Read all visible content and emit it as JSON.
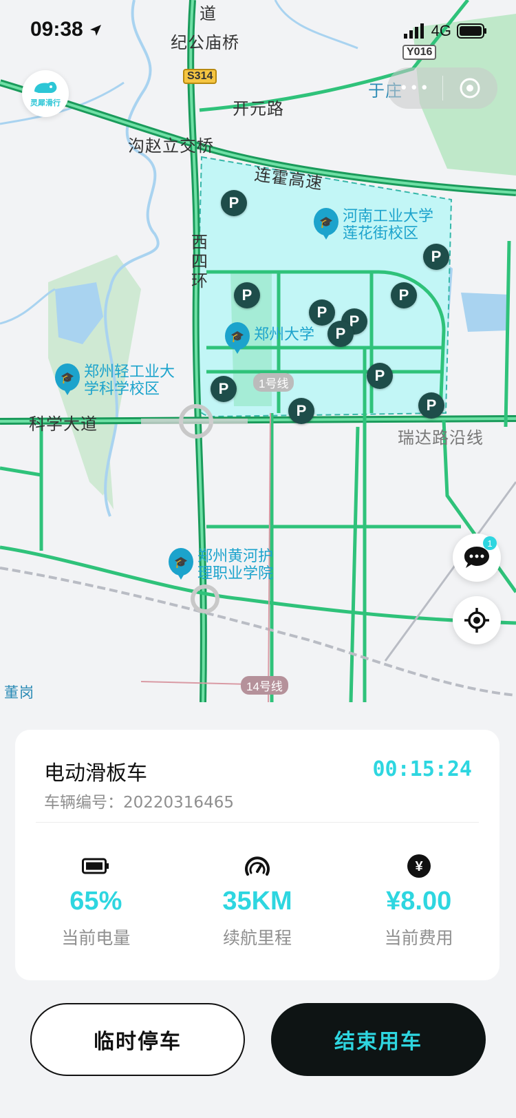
{
  "status_bar": {
    "time": "09:38",
    "network": "4G"
  },
  "app": {
    "logo_text": "灵犀滑行"
  },
  "map": {
    "labels": {
      "road_top": "道",
      "bridge1": "纪公庙桥",
      "kaiyuan": "开元路",
      "yuzhuang": "于庄",
      "gouzhao": "沟赵立交桥",
      "lianhuo": "连霍高速",
      "xisihuan": "西四环",
      "kexue": "科学大道",
      "ruida": "瑞达路沿线",
      "donggang": "董岗"
    },
    "shields": {
      "s314": "S314",
      "y016": "Y016"
    },
    "metro": {
      "line1": "1号线",
      "line14": "14号线"
    },
    "pois": {
      "henan_univ": [
        "河南工业大学",
        "莲花街校区"
      ],
      "zhengzhou_univ": "郑州大学",
      "light_industry": [
        "郑州轻工业大",
        "学科学校区"
      ],
      "yellow_river": [
        "郑州黄河护",
        "理职业学院"
      ]
    },
    "parking_label": "P",
    "message_badge": "1"
  },
  "ride": {
    "vehicle_name": "电动滑板车",
    "timer": "00:15:24",
    "vehicle_id_label": "车辆编号：20220316465",
    "stats": [
      {
        "icon": "battery-icon",
        "value": "65%",
        "label": "当前电量"
      },
      {
        "icon": "speedometer-icon",
        "value": "35KM",
        "label": "续航里程"
      },
      {
        "icon": "yen-icon",
        "value": "¥8.00",
        "label": "当前费用"
      }
    ]
  },
  "actions": {
    "pause": "临时停车",
    "end": "结束用车"
  },
  "colors": {
    "accent": "#2ed6e0",
    "dark": "#0e1414",
    "road": "#21b36a",
    "zone": "#c2f6f6"
  }
}
